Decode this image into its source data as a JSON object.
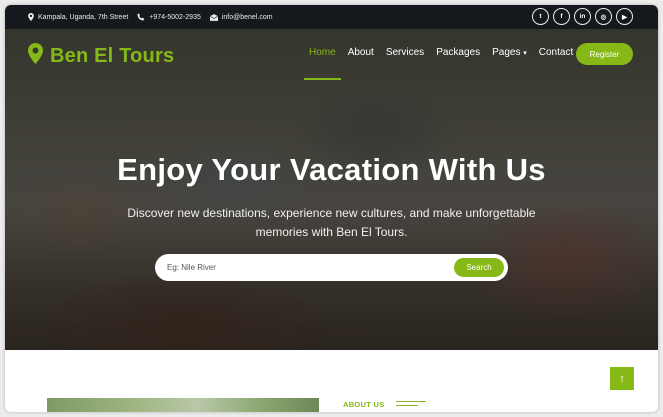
{
  "topbar": {
    "address": "Kampala, Uganda, 7th Street",
    "phone": "+974-5002-2935",
    "email": "info@benel.com",
    "socials": [
      {
        "name": "twitter",
        "glyph": "t"
      },
      {
        "name": "facebook",
        "glyph": "f"
      },
      {
        "name": "linkedin",
        "glyph": "in"
      },
      {
        "name": "instagram",
        "glyph": "◎"
      },
      {
        "name": "youtube",
        "glyph": "▶"
      }
    ]
  },
  "nav": {
    "brand": "Ben El Tours",
    "items": [
      "Home",
      "About",
      "Services",
      "Packages",
      "Pages",
      "Contact"
    ],
    "pages_caret": "▾",
    "register": "Register"
  },
  "hero": {
    "title": "Enjoy Your Vacation With Us",
    "subtitle": "Discover new destinations, experience new cultures, and make unforgettable memories with Ben El Tours.",
    "search_placeholder": "Eg: Nile River",
    "search_button": "Search"
  },
  "about": {
    "label": "ABOUT US"
  },
  "back_to_top": "↑",
  "colors": {
    "accent": "#86b817",
    "topbar_bg": "#15191d"
  }
}
